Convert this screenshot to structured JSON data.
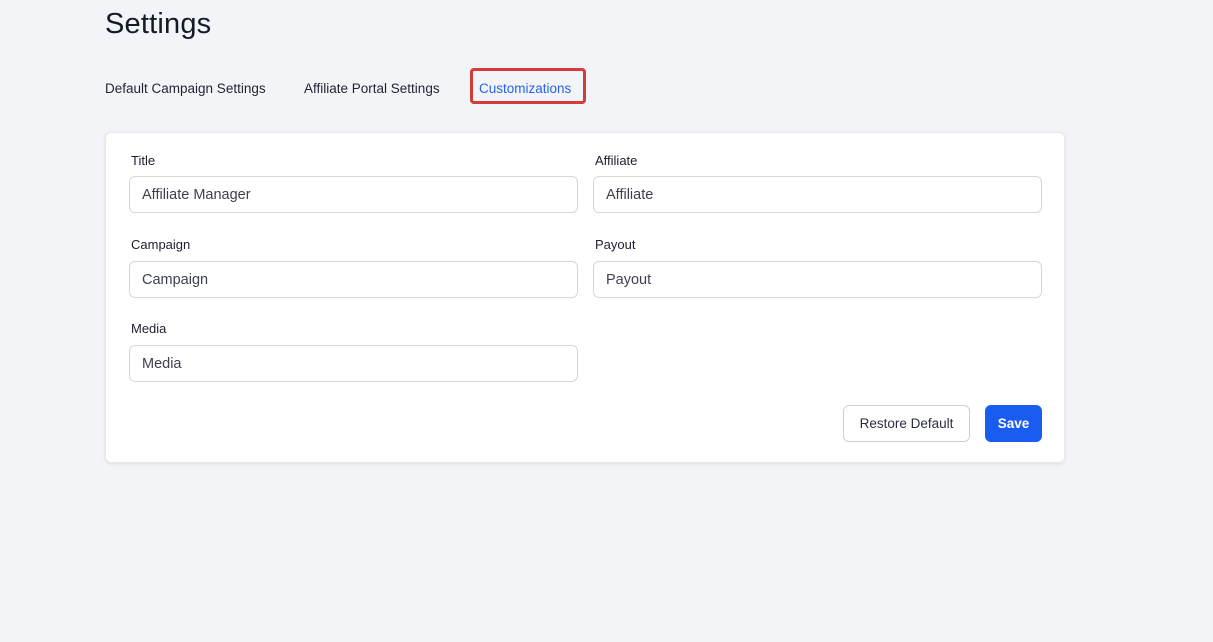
{
  "page": {
    "title": "Settings"
  },
  "tabs": [
    {
      "label": "Default Campaign Settings",
      "active": false
    },
    {
      "label": "Affiliate Portal Settings",
      "active": false
    },
    {
      "label": "Customizations",
      "active": true
    }
  ],
  "form": {
    "title": {
      "label": "Title",
      "value": "Affiliate Manager"
    },
    "affiliate": {
      "label": "Affiliate",
      "value": "Affiliate"
    },
    "campaign": {
      "label": "Campaign",
      "value": "Campaign"
    },
    "payout": {
      "label": "Payout",
      "value": "Payout"
    },
    "media": {
      "label": "Media",
      "value": "Media"
    }
  },
  "actions": {
    "restore_label": "Restore Default",
    "save_label": "Save"
  },
  "colors": {
    "accent": "#2563eb",
    "primary_button": "#1a5cf0",
    "highlight": "#d63b3b",
    "background": "#f3f4f7"
  }
}
